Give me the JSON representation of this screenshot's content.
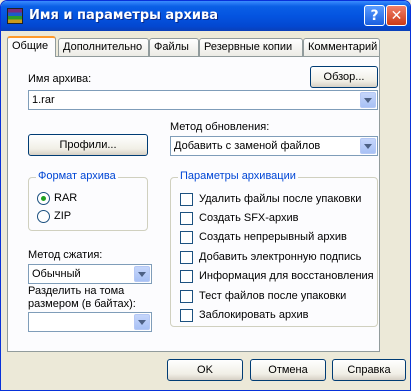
{
  "window": {
    "title": "Имя и параметры архива",
    "help_symbol": "?",
    "close_symbol": "✕"
  },
  "tabs": [
    "Общие",
    "Дополнительно",
    "Файлы",
    "Резервные копии",
    "Комментарий"
  ],
  "archive": {
    "name_label": "Имя архива:",
    "name_value": "1.rar",
    "browse_label": "Обзор..."
  },
  "profiles_label": "Профили...",
  "update": {
    "label": "Метод обновления:",
    "value": "Добавить с заменой файлов"
  },
  "format": {
    "title": "Формат архива",
    "options": [
      "RAR",
      "ZIP"
    ],
    "selected": "RAR"
  },
  "compression": {
    "label": "Метод сжатия:",
    "value": "Обычный"
  },
  "split": {
    "label_line1": "Разделить на тома",
    "label_line2": "размером (в байтах):",
    "value": ""
  },
  "params": {
    "title": "Параметры архивации",
    "options": [
      "Удалить файлы после упаковки",
      "Создать SFX-архив",
      "Создать непрерывный архив",
      "Добавить электронную подпись",
      "Информация для восстановления",
      "Тест файлов после упаковки",
      "Заблокировать архив"
    ]
  },
  "buttons": {
    "ok": "OK",
    "cancel": "Отмена",
    "help": "Справка"
  }
}
